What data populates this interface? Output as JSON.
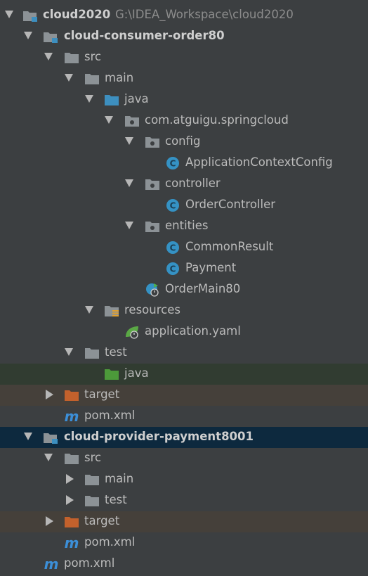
{
  "tree": {
    "root": {
      "name": "cloud2020",
      "path": "G:\\IDEA_Workspace\\cloud2020"
    },
    "consumer": {
      "name": "cloud-consumer-order80",
      "src": "src",
      "main": "main",
      "java": "java",
      "package": "com.atguigu.springcloud",
      "config": "config",
      "config_class": "ApplicationContextConfig",
      "controller": "controller",
      "controller_class": "OrderController",
      "entities": "entities",
      "entity_1": "CommonResult",
      "entity_2": "Payment",
      "main_class": "OrderMain80",
      "resources": "resources",
      "yaml": "application.yaml",
      "test": "test",
      "test_java": "java",
      "target": "target",
      "pom": "pom.xml"
    },
    "provider": {
      "name": "cloud-provider-payment8001",
      "src": "src",
      "main": "main",
      "test": "test",
      "target": "target",
      "pom": "pom.xml"
    },
    "root_pom": "pom.xml"
  },
  "colors": {
    "background": "#3c3f41",
    "selected_module": "#0d293e",
    "test_java_highlight": "#313c31",
    "target_highlight": "#45403a",
    "folder_grey": "#8c9296",
    "folder_blue": "#3d8fbf",
    "folder_green": "#4c9a3a",
    "folder_orange": "#c3612c",
    "class_blue": "#3592c4",
    "maven_blue": "#3c8fd8"
  },
  "icons": [
    "expand-arrow-icon",
    "collapse-arrow-icon",
    "module-icon",
    "folder-icon",
    "source-folder-icon",
    "package-icon",
    "class-icon",
    "spring-boot-class-icon",
    "resources-folder-icon",
    "yaml-spring-icon",
    "test-source-folder-icon",
    "excluded-folder-icon",
    "maven-icon"
  ]
}
